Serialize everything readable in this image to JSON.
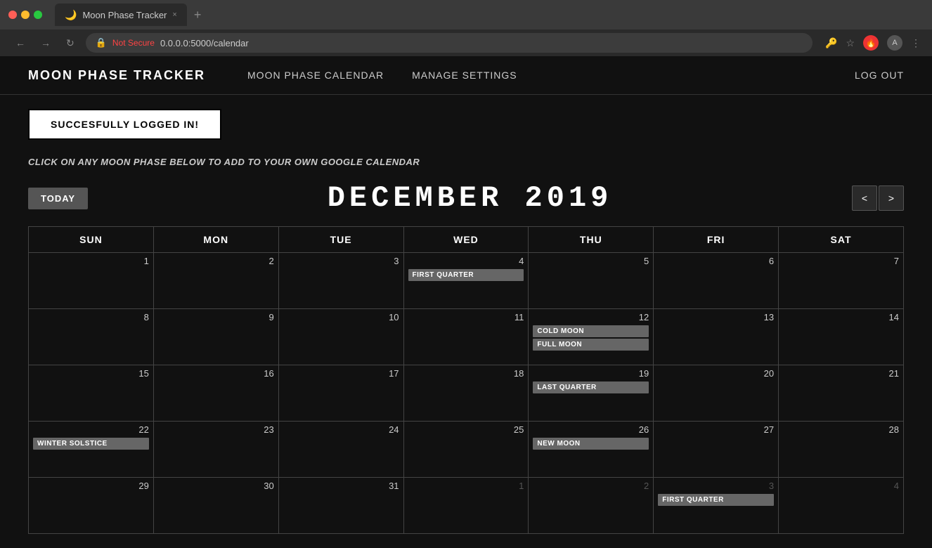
{
  "browser": {
    "tab_title": "Moon Phase Tracker",
    "tab_icon": "🌙",
    "close_label": "×",
    "new_tab_label": "+",
    "address_bar": {
      "not_secure": "Not Secure",
      "url": "0.0.0.0:5000/calendar",
      "key_icon": "🔑",
      "star_icon": "☆",
      "menu_icon": "⋮"
    },
    "nav_back": "←",
    "nav_forward": "→",
    "nav_refresh": "↻"
  },
  "nav": {
    "brand": "MOON PHASE TRACKER",
    "links": [
      {
        "label": "MOON PHASE CALENDAR",
        "href": "#"
      },
      {
        "label": "MANAGE SETTINGS",
        "href": "#"
      }
    ],
    "logout": "LOG OUT"
  },
  "flash": {
    "message": "SUCCESFULLY LOGGED IN!"
  },
  "subtitle": "CLICK ON ANY MOON PHASE BELOW TO ADD TO YOUR OWN GOOGLE CALENDAR",
  "calendar": {
    "month_title": "DECEMBER  2019",
    "today_btn": "TODAY",
    "prev_arrow": "<",
    "next_arrow": ">",
    "day_headers": [
      "SUN",
      "MON",
      "TUE",
      "WED",
      "THU",
      "FRI",
      "SAT"
    ],
    "weeks": [
      [
        {
          "num": "1",
          "events": [],
          "today": false,
          "other": false
        },
        {
          "num": "2",
          "events": [],
          "today": false,
          "other": false
        },
        {
          "num": "3",
          "events": [],
          "today": false,
          "other": false
        },
        {
          "num": "4",
          "events": [
            "FIRST QUARTER"
          ],
          "today": false,
          "other": false
        },
        {
          "num": "5",
          "events": [],
          "today": false,
          "other": false
        },
        {
          "num": "6",
          "events": [],
          "today": false,
          "other": false
        },
        {
          "num": "7",
          "events": [],
          "today": false,
          "other": false
        }
      ],
      [
        {
          "num": "8",
          "events": [],
          "today": false,
          "other": false
        },
        {
          "num": "9",
          "events": [],
          "today": false,
          "other": false
        },
        {
          "num": "10",
          "events": [],
          "today": true,
          "other": false
        },
        {
          "num": "11",
          "events": [],
          "today": false,
          "other": false
        },
        {
          "num": "12",
          "events": [
            "COLD MOON",
            "FULL MOON"
          ],
          "today": false,
          "other": false
        },
        {
          "num": "13",
          "events": [],
          "today": false,
          "other": false
        },
        {
          "num": "14",
          "events": [],
          "today": false,
          "other": false
        }
      ],
      [
        {
          "num": "15",
          "events": [],
          "today": false,
          "other": false
        },
        {
          "num": "16",
          "events": [],
          "today": false,
          "other": false
        },
        {
          "num": "17",
          "events": [],
          "today": false,
          "other": false
        },
        {
          "num": "18",
          "events": [],
          "today": false,
          "other": false
        },
        {
          "num": "19",
          "events": [
            "LAST QUARTER"
          ],
          "today": false,
          "other": false
        },
        {
          "num": "20",
          "events": [],
          "today": false,
          "other": false
        },
        {
          "num": "21",
          "events": [],
          "today": false,
          "other": false
        }
      ],
      [
        {
          "num": "22",
          "events": [
            "WINTER SOLSTICE"
          ],
          "today": false,
          "other": false
        },
        {
          "num": "23",
          "events": [],
          "today": false,
          "other": false
        },
        {
          "num": "24",
          "events": [],
          "today": false,
          "other": false
        },
        {
          "num": "25",
          "events": [],
          "today": false,
          "other": false
        },
        {
          "num": "26",
          "events": [
            "NEW MOON"
          ],
          "today": false,
          "other": false
        },
        {
          "num": "27",
          "events": [],
          "today": false,
          "other": false
        },
        {
          "num": "28",
          "events": [],
          "today": false,
          "other": false
        }
      ],
      [
        {
          "num": "29",
          "events": [],
          "today": false,
          "other": false
        },
        {
          "num": "30",
          "events": [],
          "today": false,
          "other": false
        },
        {
          "num": "31",
          "events": [],
          "today": false,
          "other": false
        },
        {
          "num": "1",
          "events": [],
          "today": false,
          "other": true
        },
        {
          "num": "2",
          "events": [],
          "today": false,
          "other": true
        },
        {
          "num": "3",
          "events": [
            "FIRST QUARTER"
          ],
          "today": false,
          "other": true
        },
        {
          "num": "4",
          "events": [],
          "today": false,
          "other": true
        }
      ]
    ]
  }
}
